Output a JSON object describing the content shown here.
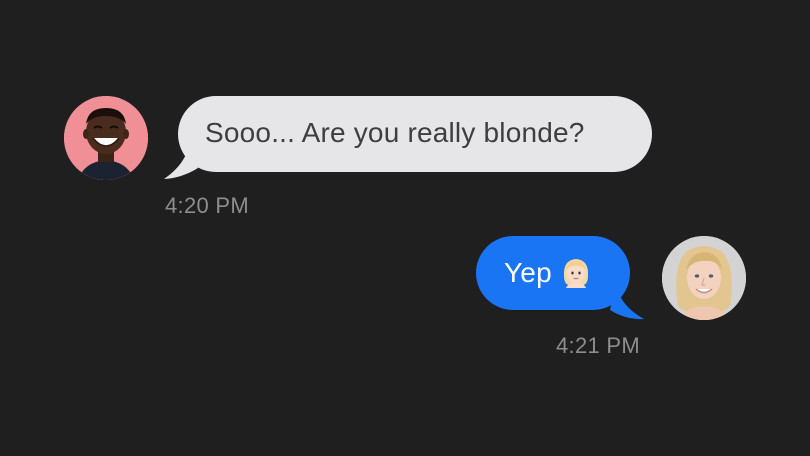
{
  "conversation": {
    "messages": [
      {
        "direction": "received",
        "text": "Sooo... Are you really blonde?",
        "time": "4:20 PM",
        "avatar": "smiling-man-avatar",
        "bubble_color": "#e6e6e8"
      },
      {
        "direction": "sent",
        "text": "Yep",
        "emoji": "blonde-woman-emoji",
        "time": "4:21 PM",
        "avatar": "smiling-woman-avatar",
        "bubble_color": "#1a75f5"
      }
    ]
  },
  "colors": {
    "background": "#1f1f1f",
    "timestamp": "#8d8d8d"
  }
}
